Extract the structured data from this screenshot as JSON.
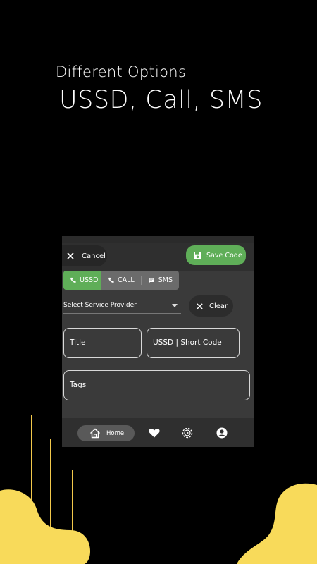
{
  "promo": {
    "subtitle": "Different Options",
    "title": "USSD, Call, SMS"
  },
  "toolbar": {
    "cancel_label": "Cancel",
    "save_label": "Save Code"
  },
  "segments": [
    {
      "label": "USSD",
      "icon": "phone-icon",
      "active": true
    },
    {
      "label": "CALL",
      "icon": "phone-icon",
      "active": false
    },
    {
      "label": "SMS",
      "icon": "message-icon",
      "active": false
    }
  ],
  "provider": {
    "placeholder": "Select Service Provider"
  },
  "clear_label": "Clear",
  "fields": {
    "title": "Title",
    "code": "USSD | Short Code",
    "tags": "Tags"
  },
  "nav": {
    "home_label": "Home",
    "items": [
      "home-icon",
      "heart-icon",
      "settings-icon",
      "account-icon"
    ]
  },
  "colors": {
    "accent": "#5fae58",
    "decor_yellow": "#f8da5a",
    "background": "#000000",
    "panel": "#3a3a3a"
  }
}
